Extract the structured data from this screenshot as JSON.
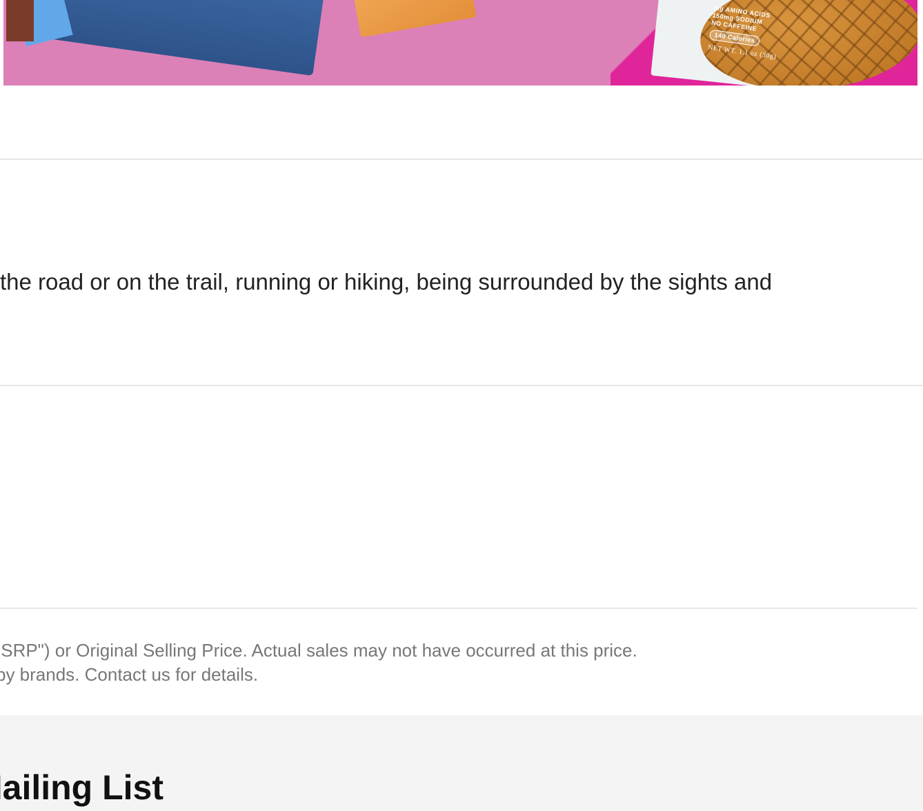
{
  "hero": {
    "waffle_lines": [
      "ing AMINO ACIDS",
      "150mg SODIUM",
      "NO CAFFEINE"
    ],
    "calories_badge": "140 Calories",
    "net_weight": "NET WT. 1.1 oz (30g)"
  },
  "description": {
    "text": "the road or on the trail, running or hiking, being surrounded by the sights and"
  },
  "disclaimer": {
    "line1": "ISRP\") or Original Selling Price. Actual sales may not have occurred at this price.",
    "line2": " by brands. Contact us for details."
  },
  "footer": {
    "mailing_title": "Mailing List"
  },
  "colors": {
    "hero_pink": "#dc80b8",
    "hero_magenta": "#e0259a",
    "divider": "#e6e6e6",
    "footer_bg": "#f4f4f4"
  }
}
